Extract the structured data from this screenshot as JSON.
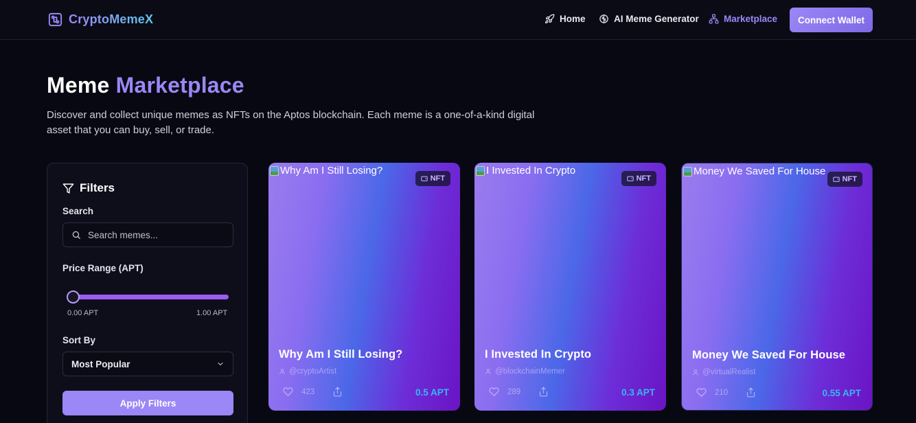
{
  "header": {
    "brand": "CryptoMemeX",
    "nav": [
      {
        "label": "Home",
        "icon": "rocket-icon"
      },
      {
        "label": "AI Meme Generator",
        "icon": "brain-icon"
      },
      {
        "label": "Marketplace",
        "icon": "network-icon",
        "active": true
      }
    ],
    "connect_wallet": "Connect Wallet"
  },
  "hero": {
    "title_main": "Meme ",
    "title_accent": "Marketplace",
    "description": "Discover and collect unique memes as NFTs on the Aptos blockchain. Each meme is a one-of-a-kind digital asset that you can buy, sell, or trade."
  },
  "filters": {
    "heading": "Filters",
    "search_label": "Search",
    "search_placeholder": "Search memes...",
    "search_value": "",
    "price_label": "Price Range (APT)",
    "price_min_label": "0.00 APT",
    "price_max_label": "1.00 APT",
    "price_slider_value": 0,
    "sort_label": "Sort By",
    "sort_value": "Most Popular",
    "apply_label": "Apply Filters"
  },
  "cards": [
    {
      "image_alt": "Why Am I Still Losing?",
      "badge": "NFT",
      "title": "Why Am I Still Losing?",
      "author": "@cryptoArtist",
      "likes": "423",
      "price": "0.5 APT"
    },
    {
      "image_alt": "I Invested In Crypto",
      "badge": "NFT",
      "title": "I Invested In Crypto",
      "author": "@blockchainMemer",
      "likes": "289",
      "price": "0.3 APT"
    },
    {
      "image_alt": "Money We Saved For House",
      "badge": "NFT",
      "title": "Money We Saved For House",
      "author": "@virtualRealist",
      "likes": "210",
      "price": "0.55 APT"
    }
  ],
  "colors": {
    "background": "#080812",
    "accent": "#9b87f5",
    "price": "#37b8f0"
  }
}
